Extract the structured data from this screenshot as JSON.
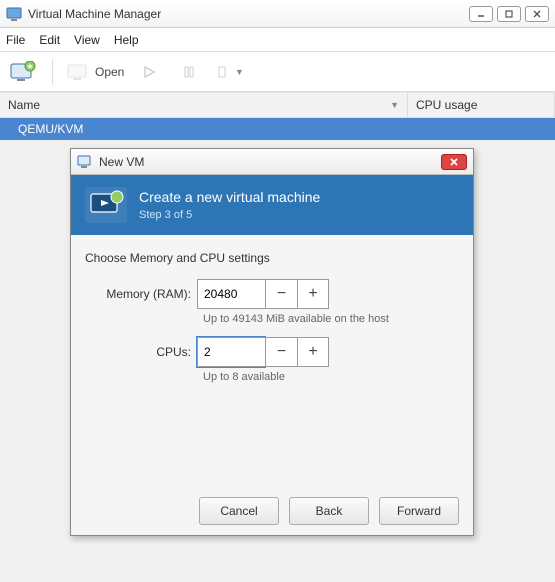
{
  "window": {
    "title": "Virtual Machine Manager"
  },
  "menu": {
    "file": "File",
    "edit": "Edit",
    "view": "View",
    "help": "Help"
  },
  "toolbar": {
    "open_label": "Open"
  },
  "list": {
    "col_name": "Name",
    "col_cpu": "CPU usage",
    "rows": [
      {
        "name": "QEMU/KVM"
      }
    ]
  },
  "dialog": {
    "title": "New VM",
    "heading": "Create a new virtual machine",
    "step": "Step 3 of 5",
    "section": "Choose Memory and CPU settings",
    "memory_label": "Memory (RAM):",
    "memory_value": "20480",
    "memory_hint": "Up to 49143 MiB available on the host",
    "cpus_label": "CPUs:",
    "cpus_value": "2",
    "cpus_hint": "Up to 8 available",
    "buttons": {
      "cancel": "Cancel",
      "back": "Back",
      "forward": "Forward"
    }
  }
}
